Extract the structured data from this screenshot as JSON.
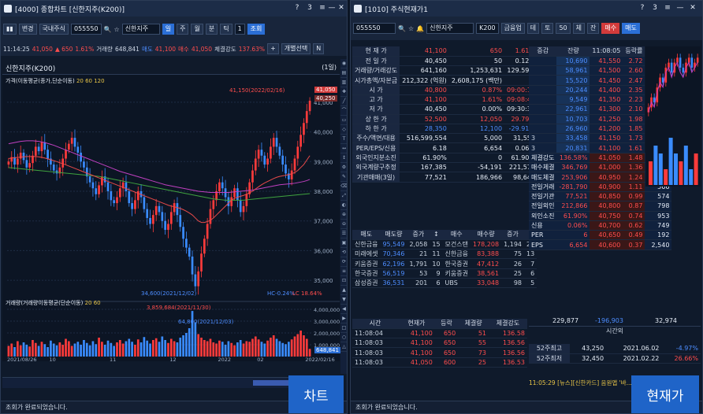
{
  "left": {
    "title": "[4000] 종합차트 [신한지주(K200)]",
    "toolbar1": {
      "type": "변경",
      "period": "국내주식",
      "code": "055550",
      "name": "신한지주",
      "btn_search": "조회",
      "tabs": [
        "일",
        "주",
        "월",
        "분",
        "틱"
      ],
      "count": "1"
    },
    "toolbar2": {
      "time": "11:14:25",
      "price": "41,050",
      "change": "▲ 650",
      "rate": "1.61%",
      "vol_label": "거래량",
      "vol": "648,841",
      "ask_label": "매도",
      "ask": "41,100",
      "bid_label": "매수",
      "bid": "41,050",
      "exec_label": "체결강도",
      "exec": "137.63%",
      "btn_plus": "+",
      "btn_indiv": "개별선택",
      "btn_n": "N"
    },
    "chart_title": "신한지주(K200)",
    "chart_period": "(1일)",
    "legend1": "가격(이동평균(종가,단순이동)",
    "legend1_vals": "20 60 120",
    "legend2": "거래량(거래량이동평균(단순이동)",
    "legend2_vals": "20 60",
    "annotations": {
      "high": "41,150(2022/02/16)",
      "low": "34,600(2021/12/02)",
      "right_price": "41,050",
      "right_price2": "40,250",
      "vol_hi": "3,859,684(2021/11/30)",
      "vol_lo": "64,800(2021/12/03)",
      "vol_right": "648,841",
      "hc": "HC-0.24%",
      "lc": "LC 18.64%"
    },
    "chart_data": {
      "type": "candlestick",
      "y_ticks": [
        "41,000",
        "40,000",
        "39,000",
        "38,000",
        "37,000",
        "36,000",
        "35,000"
      ],
      "y_range": [
        34500,
        41500
      ],
      "vol_ticks": [
        "4,000,000",
        "3,000,000",
        "2,000,000",
        "1,000,000"
      ],
      "x_ticks": [
        "2021/08/26",
        "10",
        "11",
        "12",
        "2022",
        "02",
        "2022/02/16"
      ],
      "closes": [
        39000,
        39150,
        38900,
        39100,
        39300,
        39050,
        38800,
        38950,
        39200,
        39500,
        39350,
        39650,
        39400,
        39100,
        38900,
        38700,
        38600,
        38800,
        39100,
        39400,
        39600,
        39800,
        39500,
        39300,
        39000,
        38800,
        38500,
        38300,
        38100,
        37900,
        38200,
        38500,
        38300,
        38000,
        37700,
        37600,
        37800,
        38100,
        38300,
        38000,
        37600,
        37400,
        37700,
        38000,
        37800,
        37400,
        37100,
        36900,
        37200,
        37500,
        37300,
        37000,
        36700,
        36900,
        37300,
        37600,
        37200,
        36800,
        36400,
        36100,
        35800,
        35200,
        34800,
        35300,
        35900,
        36400,
        36900,
        37400,
        37700,
        38000,
        38300,
        38100,
        37800,
        37500,
        37800,
        38100,
        37700,
        37300,
        37500,
        37900,
        38300,
        38700,
        39100,
        39400,
        39200,
        38900,
        39100,
        39500,
        39800,
        39500,
        39200,
        38900,
        38600,
        38400,
        38700,
        39100,
        39500,
        39900,
        40300,
        40700,
        41050
      ],
      "ma20": [
        39100,
        39120,
        39130,
        39140,
        39150,
        39160,
        39170,
        39170,
        39170,
        39170,
        39160,
        39140,
        39120,
        39090,
        39060,
        39030,
        39000,
        38960,
        38930,
        38890,
        38850,
        38810,
        38770,
        38730,
        38690,
        38650,
        38610,
        38570,
        38530,
        38490,
        38450,
        38410,
        38370,
        38330,
        38290,
        38250,
        38210,
        38170,
        38130,
        38090,
        38050,
        38010,
        37970,
        37930,
        37890,
        37850,
        37810,
        37770,
        37730,
        37690,
        37650,
        37610,
        37570,
        37530,
        37500,
        37480,
        37450,
        37420,
        37380,
        37330,
        37270,
        37200,
        37100,
        37000,
        36950,
        36950,
        36980,
        37020,
        37100,
        37200,
        37300,
        37400,
        37500,
        37600,
        37700,
        37760,
        37800,
        37830,
        37860,
        37900,
        37950,
        38000,
        38080,
        38150,
        38220,
        38280,
        38330,
        38380,
        38430,
        38470,
        38500,
        38520,
        38540,
        38560,
        38590,
        38630,
        38700,
        38800,
        38900,
        39050,
        39200
      ],
      "ma60": [
        39600,
        39620,
        39640,
        39660,
        39680,
        39690,
        39700,
        39700,
        39700,
        39690,
        39680,
        39660,
        39640,
        39610,
        39580,
        39550,
        39510,
        39470,
        39430,
        39390,
        39350,
        39310,
        39270,
        39230,
        39190,
        39150,
        39110,
        39070,
        39030,
        38990,
        38950,
        38910,
        38870,
        38830,
        38790,
        38750,
        38710,
        38670,
        38640,
        38610,
        38580,
        38550,
        38520,
        38490,
        38460,
        38430,
        38400,
        38370,
        38340,
        38310,
        38280,
        38250,
        38220,
        38200,
        38180,
        38160,
        38140,
        38120,
        38100,
        38080,
        38060,
        38040,
        38020,
        38000,
        37990,
        37980,
        37970,
        37960,
        37960,
        37960,
        37960,
        37960,
        37960,
        37960,
        37970,
        37980,
        37990,
        38000,
        38010,
        38020,
        38030,
        38040,
        38060,
        38080,
        38100,
        38120,
        38140,
        38160,
        38180,
        38200,
        38220,
        38230,
        38240,
        38250,
        38260,
        38270,
        38290,
        38310,
        38330,
        38360,
        38400
      ],
      "ma120": [
        38800,
        38790,
        38780,
        38770,
        38760,
        38750,
        38740,
        38730,
        38720,
        38710,
        38700,
        38690,
        38680,
        38670,
        38660,
        38650,
        38640,
        38630,
        38620,
        38610,
        38600,
        38590,
        38580,
        38570,
        38560,
        38550,
        38540,
        38530,
        38520,
        38510,
        38500,
        38480,
        38460,
        38440,
        38420,
        38400,
        38380,
        38360,
        38340,
        38320,
        38300,
        38280,
        38260,
        38240,
        38220,
        38200,
        38180,
        38160,
        38140,
        38120,
        38100,
        38080,
        38060,
        38040,
        38020,
        38000,
        37980,
        37960,
        37940,
        37920,
        37900,
        37880,
        37860,
        37840,
        37820,
        37800,
        37780,
        37760,
        37740,
        37730,
        37720,
        37710,
        37700,
        37700,
        37700,
        37700,
        37700,
        37700,
        37700,
        37710,
        37720,
        37730,
        37740,
        37750,
        37760,
        37770,
        37780,
        37790,
        37800,
        37810,
        37820,
        37830,
        37840,
        37850,
        37860,
        37870,
        37880,
        37890,
        37900,
        37910,
        37920
      ],
      "volumes": [
        900000,
        1100000,
        800000,
        1300000,
        950000,
        1200000,
        1000000,
        850000,
        1400000,
        1150000,
        900000,
        1250000,
        1050000,
        800000,
        1350000,
        1100000,
        950000,
        1200000,
        1000000,
        1500000,
        1300000,
        900000,
        1100000,
        1250000,
        1000000,
        1400000,
        1150000,
        950000,
        1300000,
        1050000,
        1600000,
        1250000,
        1000000,
        1350000,
        1150000,
        900000,
        1200000,
        1400000,
        1100000,
        1300000,
        1500000,
        1250000,
        1000000,
        1450000,
        1200000,
        1650000,
        1350000,
        1100000,
        1400000,
        1550000,
        1250000,
        1700000,
        1400000,
        1150000,
        1500000,
        1300000,
        1200000,
        1600000,
        1800000,
        2000000,
        2400000,
        3859684,
        2900000,
        1900000,
        1600000,
        1400000,
        1300000,
        1500000,
        1200000,
        1100000,
        1350000,
        1250000,
        1000000,
        1300000,
        1150000,
        950000,
        1200000,
        1400000,
        1100000,
        1300000,
        1250000,
        1500000,
        1700000,
        1450000,
        1250000,
        1100000,
        1350000,
        1600000,
        1800000,
        1500000,
        1300000,
        1150000,
        1050000,
        1250000,
        1450000,
        1700000,
        1900000,
        2200000,
        1800000,
        1500000,
        648841
      ]
    }
  },
  "right": {
    "title": "[1010] 주식현재가1",
    "toolbar1": {
      "code": "055550",
      "name": "신한지주",
      "market": "K200",
      "btn": "금융업",
      "tabs": [
        "테",
        "토",
        "50",
        "체",
        "잔"
      ],
      "btn_buy": "매수",
      "btn_sell": "매도"
    },
    "quote": [
      {
        "label": "현 재 가",
        "v1": "41,100",
        "v2": "650",
        "v3": "1.61%",
        "c": "red"
      },
      {
        "label": "전 일 가",
        "v1": "40,450",
        "v2": "50",
        "v3": "0.12%",
        "c": "wht"
      },
      {
        "label": "거래량/거래강도",
        "v1": "641,160",
        "v2": "1,253,631",
        "v3": "129.59%",
        "c": "wht"
      },
      {
        "label": "시가총액/자본금",
        "v1": "212,322 (억원)",
        "v2": "2,608,175 (백만)",
        "v3": "",
        "c": "wht"
      },
      {
        "label": "시 가",
        "v1": "40,800",
        "v2": "0.87%",
        "v3": "09:00:16",
        "c": "red"
      },
      {
        "label": "고 가",
        "v1": "41,100",
        "v2": "1.61%",
        "v3": "09:08:49",
        "c": "red"
      },
      {
        "label": "저 가",
        "v1": "40,450",
        "v2": "0.00%",
        "v3": "09:30:35",
        "c": "wht"
      },
      {
        "label": "상 한 가",
        "v1": "52,500",
        "v2": "12,050",
        "v3": "29.79%",
        "c": "red"
      },
      {
        "label": "하 한 가",
        "v1": "28,350",
        "v2": "12,100",
        "v3": "-29.91%",
        "c": "blue"
      },
      {
        "label": "주수/액면/대용",
        "v1": "516,599,554",
        "v2": "5,000",
        "v3": "31,550",
        "c": "wht"
      },
      {
        "label": "PER/EPS/신용",
        "v1": "6.18",
        "v2": "6,654",
        "v3": "0.06%",
        "c": "wht"
      },
      {
        "label": "외국인지분소진",
        "v1": "61.90%",
        "v2": "0",
        "v3": "61.90%",
        "c": "wht"
      },
      {
        "label": "외국계량구추정",
        "v1": "167,385",
        "v2": "-54,191",
        "v3": "221,576",
        "c": "wht"
      },
      {
        "label": "기관매매(3일)",
        "v1": "77,521",
        "v2": "186,966",
        "v3": "98,649",
        "c": "wht"
      }
    ],
    "orderbook": {
      "headers": [
        "증감",
        "잔량",
        "11:08:05",
        "등락률",
        "잔량"
      ],
      "asks": [
        {
          "qty": "10,690",
          "price": "41,550",
          "rate": "2.72"
        },
        {
          "qty": "58,961",
          "price": "41,500",
          "rate": "2.60"
        },
        {
          "qty": "15,520",
          "price": "41,450",
          "rate": "2.47"
        },
        {
          "qty": "20,244",
          "price": "41,400",
          "rate": "2.35"
        },
        {
          "qty": "9,549",
          "price": "41,350",
          "rate": "2.23"
        },
        {
          "qty": "22,961",
          "price": "41,300",
          "rate": "2.10"
        },
        {
          "qty": "10,703",
          "price": "41,250",
          "rate": "1.98"
        },
        {
          "qty": "26,960",
          "price": "41,200",
          "rate": "1.85"
        },
        {
          "qty": "33,458",
          "price": "41,150",
          "rate": "1.73",
          "chg": "3"
        },
        {
          "qty": "20,831",
          "price": "41,100",
          "rate": "1.61",
          "chg": "3"
        }
      ],
      "bids": [
        {
          "label": "체결강도",
          "lv": "136.58%",
          "price": "41,050",
          "rate": "1.48",
          "qty": "8,304"
        },
        {
          "label": "매수체결",
          "lv": "346,769",
          "price": "41,000",
          "rate": "1.36",
          "qty": "15,754"
        },
        {
          "label": "매도체결",
          "lv": "253,906",
          "price": "40,950",
          "rate": "1.24",
          "qty": "2,544"
        },
        {
          "label": "전일거래",
          "lv": "-281,790",
          "price": "40,900",
          "rate": "1.11",
          "qty": "566"
        },
        {
          "label": "전일기관",
          "lv": "77,521",
          "price": "40,850",
          "rate": "0.99",
          "qty": "574"
        },
        {
          "label": "전일외인",
          "lv": "212,866",
          "price": "40,800",
          "rate": "0.87",
          "qty": "798"
        },
        {
          "label": "외인소진",
          "lv": "61.90%",
          "price": "40,750",
          "rate": "0.74",
          "qty": "953"
        },
        {
          "label": "신용",
          "lv": "0.06%",
          "price": "40,700",
          "rate": "0.62",
          "qty": "749"
        },
        {
          "label": "PER",
          "lv": "6",
          "price": "40,650",
          "rate": "0.49",
          "qty": "192"
        },
        {
          "label": "EPS",
          "lv": "6,654",
          "price": "40,600",
          "rate": "0.37",
          "qty": "2,540"
        }
      ],
      "total_ask": "229,877",
      "total_diff": "-196,903",
      "total_bid": "32,974",
      "time_label": "시간외",
      "w52": [
        {
          "label": "52주최고",
          "price": "43,250",
          "date": "2021.06.02",
          "rate": "-4.97%"
        },
        {
          "label": "52주최저",
          "price": "32,450",
          "date": "2021.02.22",
          "rate": "26.66%"
        }
      ]
    },
    "broker_headers": [
      "매도",
      "매도량",
      "증가",
      "↕",
      "매수",
      "매수량",
      "증가",
      "↕"
    ],
    "brokers": [
      [
        "신한금융",
        "95,549",
        "2,058",
        "15",
        "모건스탠",
        "178,208",
        "1,194",
        "28"
      ],
      [
        "미래에셋",
        "70,346",
        "21",
        "11",
        "신한금융",
        "83,388",
        "75",
        "13"
      ],
      [
        "키움증권",
        "62,196",
        "1,791",
        "10",
        "한국증권",
        "47,412",
        "26",
        "7"
      ],
      [
        "한국증권",
        "56,519",
        "53",
        "9",
        "키움증권",
        "38,561",
        "25",
        "6"
      ],
      [
        "삼성증권",
        "36,531",
        "201",
        "6",
        "UBS",
        "33,048",
        "98",
        "5"
      ]
    ],
    "ticks_headers": [
      "시간",
      "현재가",
      "등락",
      "체결량",
      "체결강도"
    ],
    "ticks": [
      [
        "11:08:04",
        "41,100",
        "650",
        "51",
        "136.58"
      ],
      [
        "11:08:03",
        "41,100",
        "650",
        "55",
        "136.56"
      ],
      [
        "11:08:03",
        "41,100",
        "650",
        "73",
        "136.56"
      ],
      [
        "11:08:03",
        "41,050",
        "600",
        "25",
        "136.53"
      ]
    ],
    "news": "11:05:29 [뉴스][신한카드] 음원앱 '바...",
    "minichart": {
      "closes": [
        40600,
        40700,
        40650,
        40800,
        40900,
        40850,
        41000,
        41050,
        40950,
        41050,
        41100,
        41000,
        40950,
        41050,
        41100,
        41000,
        41050,
        41100
      ],
      "bars": [
        3,
        5,
        4,
        2,
        6,
        4,
        3,
        5,
        2,
        4
      ]
    }
  },
  "status_left": "조회가 완료되었습니다.",
  "status_right": "조회가 완료되었습니다.",
  "badge_left": "차트",
  "badge_right": "현재가"
}
